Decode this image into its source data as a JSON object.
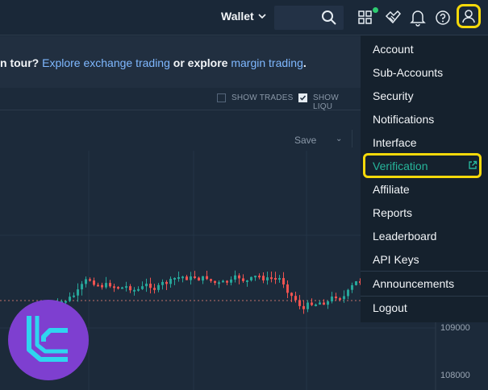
{
  "topbar": {
    "wallet_label": "Wallet",
    "icons": [
      "search-icon",
      "apps-icon",
      "handshake-icon",
      "bell-icon",
      "help-icon",
      "user-icon"
    ]
  },
  "tour": {
    "prefix": "n tour? ",
    "link1": "Explore exchange trading",
    "middle": " or explore ",
    "link2": "margin trading",
    "suffix": "."
  },
  "toolbar": {
    "show_trades": "SHOW TRADES",
    "show_trades_checked": false,
    "show_liq": "SHOW LIQU",
    "show_liq_checked": true
  },
  "chart": {
    "save_label": "Save",
    "price_labels": [
      "109000",
      "108000"
    ]
  },
  "menu": {
    "items": [
      "Account",
      "Sub-Accounts",
      "Security",
      "Notifications",
      "Interface",
      "Verification",
      "Affiliate",
      "Reports",
      "Leaderboard",
      "API Keys",
      "Announcements",
      "Logout"
    ]
  },
  "colors": {
    "accent_highlight": "#f5d90a",
    "link": "#7fb8ff",
    "teal": "#27b59b",
    "candle_up": "#26a69a",
    "candle_down": "#ef5350",
    "logo_bg": "#7e3fd0",
    "logo_fg": "#2fd4f0"
  }
}
